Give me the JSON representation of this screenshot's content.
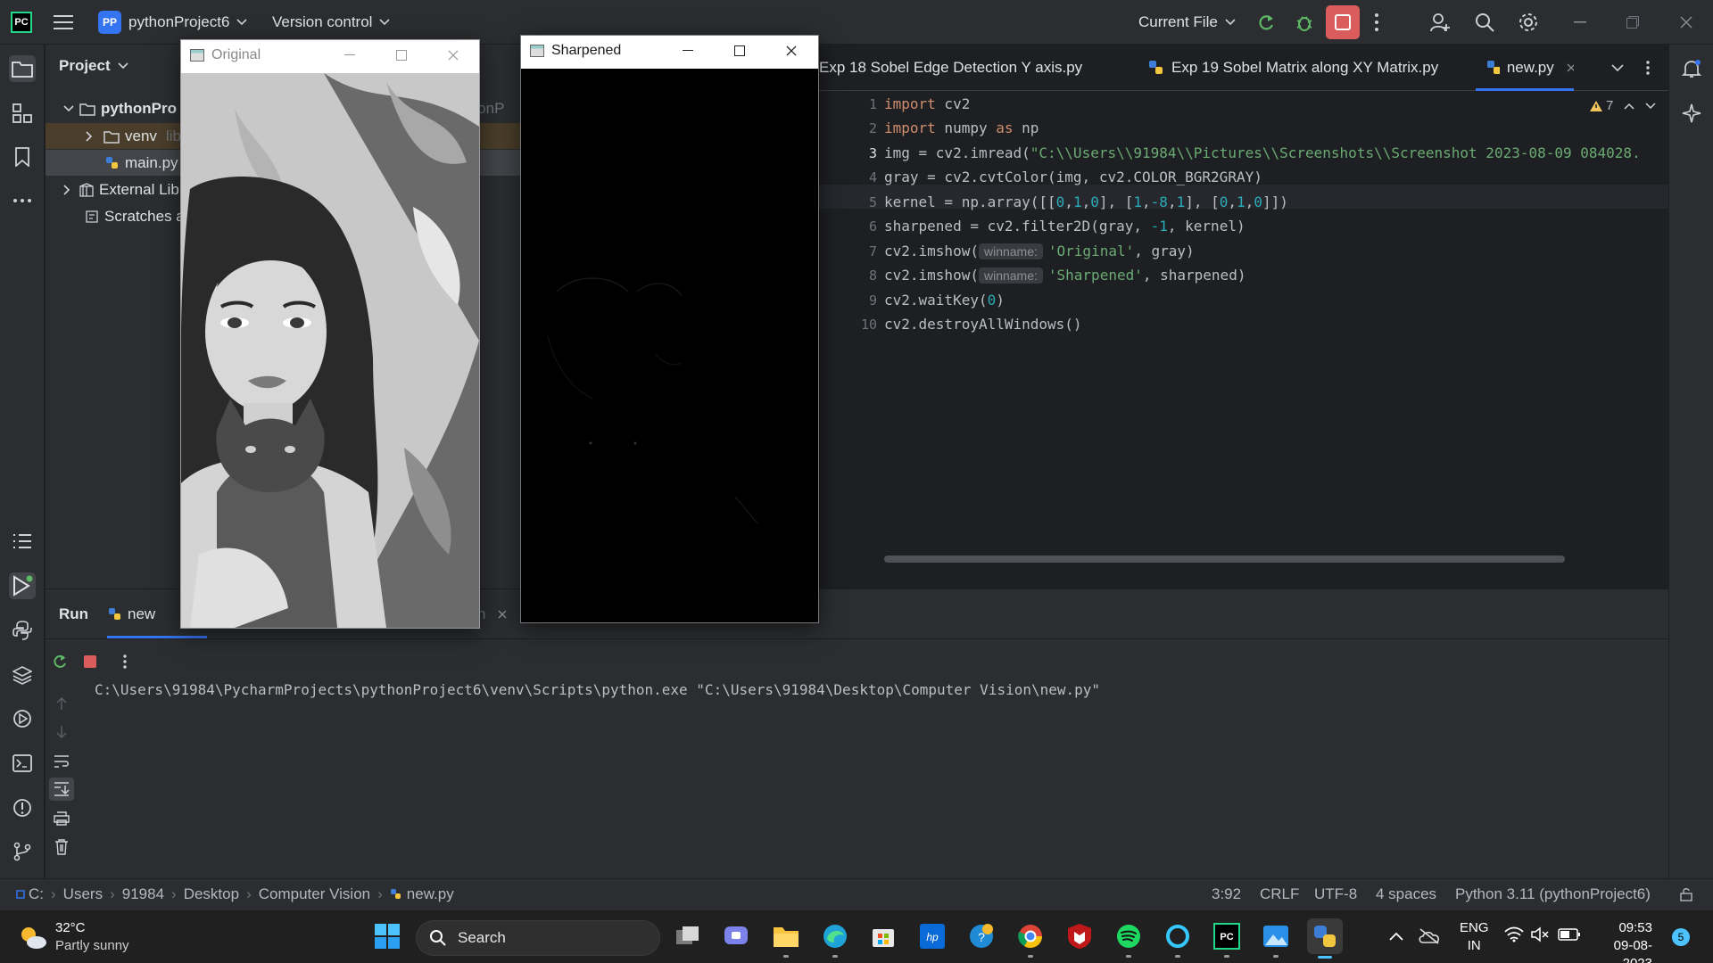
{
  "titlebar": {
    "project_badge": "PP",
    "project_name": "pythonProject6",
    "version_control": "Version control",
    "run_config": "Current File"
  },
  "project_pane": {
    "title": "Project",
    "tree": {
      "root": "pythonPro",
      "root_tail": "thonP",
      "venv": "venv",
      "venv_hint": "lib",
      "main": "main.py",
      "external": "External Lib",
      "scratches": "Scratches a"
    }
  },
  "editor": {
    "tabs": [
      {
        "label": "Exp 18 Sobel Edge Detection Y axis.py"
      },
      {
        "label": "Exp 19 Sobel Matrix along XY Matrix.py"
      },
      {
        "label": "new.py"
      }
    ],
    "warnings": "7",
    "line_numbers": [
      "1",
      "2",
      "3",
      "4",
      "5",
      "6",
      "7",
      "8",
      "9",
      "10"
    ],
    "hint_winname": "winname:"
  },
  "run_panel": {
    "tab_run": "Run",
    "tab_new": "new",
    "tab_hidden_tail": "n",
    "output": "C:\\Users\\91984\\PycharmProjects\\pythonProject6\\venv\\Scripts\\python.exe \"C:\\Users\\91984\\Desktop\\Computer Vision\\new.py\""
  },
  "statusbar": {
    "breadcrumb": [
      "C:",
      "Users",
      "91984",
      "Desktop",
      "Computer Vision",
      "new.py"
    ],
    "position": "3:92",
    "line_sep": "CRLF",
    "encoding": "UTF-8",
    "indent": "4 spaces",
    "interpreter": "Python 3.11 (pythonProject6)"
  },
  "windows": {
    "original_title": "Original",
    "sharpened_title": "Sharpened"
  },
  "taskbar": {
    "weather_temp": "32°C",
    "weather_desc": "Partly sunny",
    "search": "Search",
    "lang_top": "ENG",
    "lang_bottom": "IN",
    "time": "09:53",
    "date": "09-08-2023",
    "notif_count": "5"
  },
  "colors": {
    "accent": "#3574f0",
    "stop": "#db5c5c",
    "keyword": "#cf8e6d",
    "string": "#6aab73",
    "number": "#2aacb8"
  }
}
